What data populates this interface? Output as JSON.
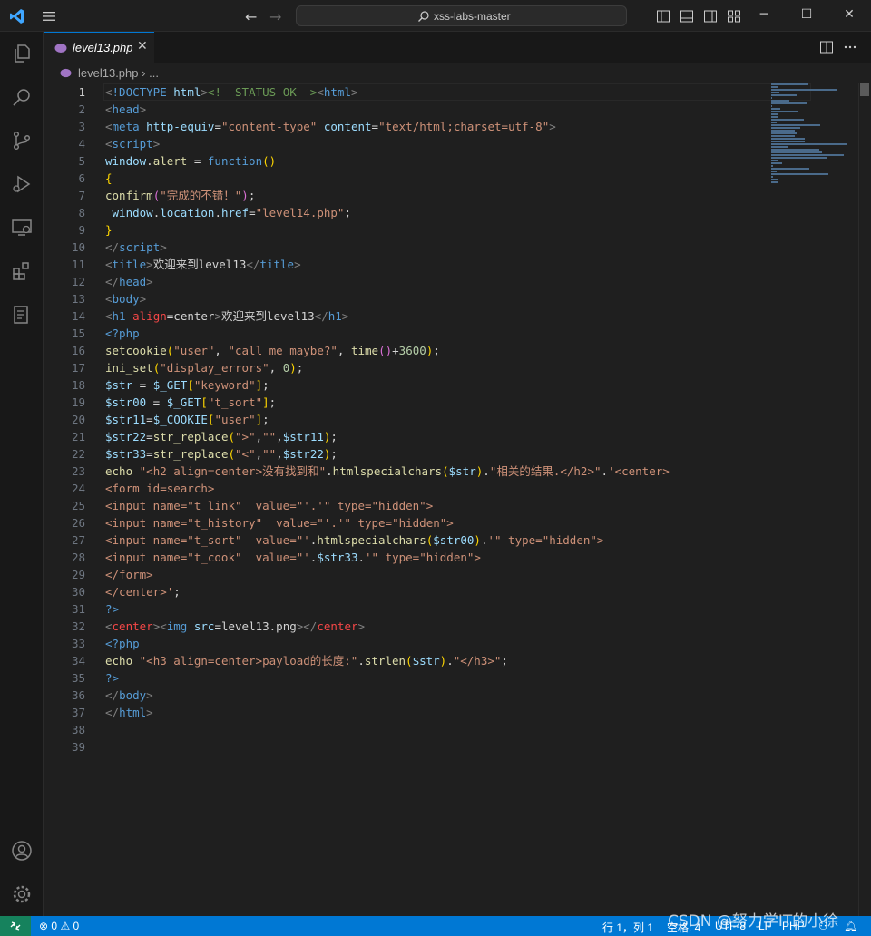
{
  "window": {
    "search_text": "xss-labs-master"
  },
  "tab": {
    "label": "level13.php",
    "close": "✕"
  },
  "breadcrumb": {
    "file": "level13.php",
    "sep": "›",
    "rest": "..."
  },
  "editor": {
    "current_line": 1,
    "lines": [
      [
        [
          "punct",
          "<"
        ],
        [
          "tag",
          "!DOCTYPE"
        ],
        [
          "plain",
          " "
        ],
        [
          "attr",
          "html"
        ],
        [
          "punct",
          ">"
        ],
        [
          "cm",
          "<!--STATUS OK-->"
        ],
        [
          "punct",
          "<"
        ],
        [
          "tag",
          "html"
        ],
        [
          "punct",
          ">"
        ]
      ],
      [
        [
          "punct",
          "<"
        ],
        [
          "tag",
          "head"
        ],
        [
          "punct",
          ">"
        ]
      ],
      [
        [
          "punct",
          "<"
        ],
        [
          "tag",
          "meta"
        ],
        [
          "plain",
          " "
        ],
        [
          "attr",
          "http-equiv"
        ],
        [
          "plain",
          "="
        ],
        [
          "str",
          "\"content-type\""
        ],
        [
          "plain",
          " "
        ],
        [
          "attr",
          "content"
        ],
        [
          "plain",
          "="
        ],
        [
          "str",
          "\"text/html;charset=utf-8\""
        ],
        [
          "punct",
          ">"
        ]
      ],
      [
        [
          "punct",
          "<"
        ],
        [
          "tag",
          "script"
        ],
        [
          "punct",
          ">"
        ]
      ],
      [
        [
          "attr",
          "window"
        ],
        [
          "plain",
          "."
        ],
        [
          "fn",
          "alert"
        ],
        [
          "plain",
          " = "
        ],
        [
          "tag",
          "function"
        ],
        [
          "gold",
          "()"
        ]
      ],
      [
        [
          "gold",
          "{"
        ]
      ],
      [
        [
          "fn",
          "confirm"
        ],
        [
          "pink",
          "("
        ],
        [
          "str",
          "\"完成的不错！\""
        ],
        [
          "pink",
          ")"
        ],
        [
          "plain",
          ";"
        ]
      ],
      [
        [
          "plain",
          " "
        ],
        [
          "attr",
          "window"
        ],
        [
          "plain",
          "."
        ],
        [
          "attr",
          "location"
        ],
        [
          "plain",
          "."
        ],
        [
          "attr",
          "href"
        ],
        [
          "plain",
          "="
        ],
        [
          "str",
          "\"level14.php\""
        ],
        [
          "plain",
          ";"
        ]
      ],
      [
        [
          "gold",
          "}"
        ]
      ],
      [
        [
          "punct",
          "</"
        ],
        [
          "tag",
          "script"
        ],
        [
          "punct",
          ">"
        ]
      ],
      [
        [
          "punct",
          "<"
        ],
        [
          "tag",
          "title"
        ],
        [
          "punct",
          ">"
        ],
        [
          "plain",
          "欢迎来到level13"
        ],
        [
          "punct",
          "</"
        ],
        [
          "tag",
          "title"
        ],
        [
          "punct",
          ">"
        ]
      ],
      [
        [
          "punct",
          "</"
        ],
        [
          "tag",
          "head"
        ],
        [
          "punct",
          ">"
        ]
      ],
      [
        [
          "punct",
          "<"
        ],
        [
          "tag",
          "body"
        ],
        [
          "punct",
          ">"
        ]
      ],
      [
        [
          "punct",
          "<"
        ],
        [
          "tag",
          "h1"
        ],
        [
          "plain",
          " "
        ],
        [
          "red",
          "align"
        ],
        [
          "plain",
          "=center"
        ],
        [
          "punct",
          ">"
        ],
        [
          "plain",
          "欢迎来到level13"
        ],
        [
          "punct",
          "</"
        ],
        [
          "tag",
          "h1"
        ],
        [
          "punct",
          ">"
        ]
      ],
      [
        [
          "tag",
          "<?php"
        ]
      ],
      [
        [
          "fn",
          "setcookie"
        ],
        [
          "gold",
          "("
        ],
        [
          "str",
          "\"user\""
        ],
        [
          "plain",
          ", "
        ],
        [
          "str",
          "\"call me maybe?\""
        ],
        [
          "plain",
          ", "
        ],
        [
          "fn",
          "time"
        ],
        [
          "pink",
          "()"
        ],
        [
          "plain",
          "+"
        ],
        [
          "num",
          "3600"
        ],
        [
          "gold",
          ")"
        ],
        [
          "plain",
          ";"
        ]
      ],
      [
        [
          "fn",
          "ini_set"
        ],
        [
          "gold",
          "("
        ],
        [
          "str",
          "\"display_errors\""
        ],
        [
          "plain",
          ", "
        ],
        [
          "num",
          "0"
        ],
        [
          "gold",
          ")"
        ],
        [
          "plain",
          ";"
        ]
      ],
      [
        [
          "attr",
          "$str"
        ],
        [
          "plain",
          " = "
        ],
        [
          "attr",
          "$_GET"
        ],
        [
          "gold",
          "["
        ],
        [
          "str",
          "\"keyword\""
        ],
        [
          "gold",
          "]"
        ],
        [
          "plain",
          ";"
        ]
      ],
      [
        [
          "attr",
          "$str00"
        ],
        [
          "plain",
          " = "
        ],
        [
          "attr",
          "$_GET"
        ],
        [
          "gold",
          "["
        ],
        [
          "str",
          "\"t_sort\""
        ],
        [
          "gold",
          "]"
        ],
        [
          "plain",
          ";"
        ]
      ],
      [
        [
          "attr",
          "$str11"
        ],
        [
          "plain",
          "="
        ],
        [
          "attr",
          "$_COOKIE"
        ],
        [
          "gold",
          "["
        ],
        [
          "str",
          "\"user\""
        ],
        [
          "gold",
          "]"
        ],
        [
          "plain",
          ";"
        ]
      ],
      [
        [
          "attr",
          "$str22"
        ],
        [
          "plain",
          "="
        ],
        [
          "fn",
          "str_replace"
        ],
        [
          "gold",
          "("
        ],
        [
          "str",
          "\">\""
        ],
        [
          "plain",
          ","
        ],
        [
          "str",
          "\"\""
        ],
        [
          "plain",
          ","
        ],
        [
          "attr",
          "$str11"
        ],
        [
          "gold",
          ")"
        ],
        [
          "plain",
          ";"
        ]
      ],
      [
        [
          "attr",
          "$str33"
        ],
        [
          "plain",
          "="
        ],
        [
          "fn",
          "str_replace"
        ],
        [
          "gold",
          "("
        ],
        [
          "str",
          "\"<\""
        ],
        [
          "plain",
          ","
        ],
        [
          "str",
          "\"\""
        ],
        [
          "plain",
          ","
        ],
        [
          "attr",
          "$str22"
        ],
        [
          "gold",
          ")"
        ],
        [
          "plain",
          ";"
        ]
      ],
      [
        [
          "fn",
          "echo"
        ],
        [
          "plain",
          " "
        ],
        [
          "str",
          "\"<h2 align=center>没有找到和\""
        ],
        [
          "plain",
          "."
        ],
        [
          "fn",
          "htmlspecialchars"
        ],
        [
          "gold",
          "("
        ],
        [
          "attr",
          "$str"
        ],
        [
          "gold",
          ")"
        ],
        [
          "plain",
          "."
        ],
        [
          "str",
          "\"相关的结果.</h2>\""
        ],
        [
          "plain",
          "."
        ],
        [
          "str",
          "'<center>"
        ]
      ],
      [
        [
          "str",
          "<form id=search>"
        ]
      ],
      [
        [
          "str",
          "<input name=\"t_link\"  value=\"'.'\" type=\"hidden\">"
        ]
      ],
      [
        [
          "str",
          "<input name=\"t_history\"  value=\"'.'\" type=\"hidden\">"
        ]
      ],
      [
        [
          "str",
          "<input name=\"t_sort\"  value=\"'"
        ],
        [
          "plain",
          "."
        ],
        [
          "fn",
          "htmlspecialchars"
        ],
        [
          "gold",
          "("
        ],
        [
          "attr",
          "$str00"
        ],
        [
          "gold",
          ")"
        ],
        [
          "plain",
          "."
        ],
        [
          "str",
          "'\" type=\"hidden\">"
        ]
      ],
      [
        [
          "str",
          "<input name=\"t_cook\"  value=\"'"
        ],
        [
          "plain",
          "."
        ],
        [
          "attr",
          "$str33"
        ],
        [
          "plain",
          "."
        ],
        [
          "str",
          "'\" type=\"hidden\">"
        ]
      ],
      [
        [
          "str",
          "</form>"
        ]
      ],
      [
        [
          "str",
          "</center>'"
        ],
        [
          "plain",
          ";"
        ]
      ],
      [
        [
          "tag",
          "?>"
        ]
      ],
      [
        [
          "punct",
          "<"
        ],
        [
          "red",
          "center"
        ],
        [
          "punct",
          ">"
        ],
        [
          "punct",
          "<"
        ],
        [
          "tag",
          "img"
        ],
        [
          "plain",
          " "
        ],
        [
          "attr",
          "src"
        ],
        [
          "plain",
          "=level13.png"
        ],
        [
          "punct",
          ">"
        ],
        [
          "punct",
          "</"
        ],
        [
          "red",
          "center"
        ],
        [
          "punct",
          ">"
        ]
      ],
      [
        [
          "tag",
          "<?php"
        ]
      ],
      [
        [
          "fn",
          "echo"
        ],
        [
          "plain",
          " "
        ],
        [
          "str",
          "\"<h3 align=center>payload的长度:\""
        ],
        [
          "plain",
          "."
        ],
        [
          "fn",
          "strlen"
        ],
        [
          "gold",
          "("
        ],
        [
          "attr",
          "$str"
        ],
        [
          "gold",
          ")"
        ],
        [
          "plain",
          "."
        ],
        [
          "str",
          "\"</h3>\""
        ],
        [
          "plain",
          ";"
        ]
      ],
      [
        [
          "tag",
          "?>"
        ]
      ],
      [
        [
          "punct",
          "</"
        ],
        [
          "tag",
          "body"
        ],
        [
          "punct",
          ">"
        ]
      ],
      [
        [
          "punct",
          "</"
        ],
        [
          "tag",
          "html"
        ],
        [
          "punct",
          ">"
        ]
      ],
      [],
      []
    ]
  },
  "status": {
    "problems": "0",
    "warnings": "0",
    "position": "行 1，列 1",
    "spaces": "空格: 4",
    "encoding": "UTF-8",
    "eol": "LF",
    "language": "PHP"
  },
  "watermark": "CSDN @努力学IT的小徐",
  "colors": {
    "accent": "#0078d4",
    "remote": "#16825d",
    "editor_bg": "#1f1f1f"
  }
}
